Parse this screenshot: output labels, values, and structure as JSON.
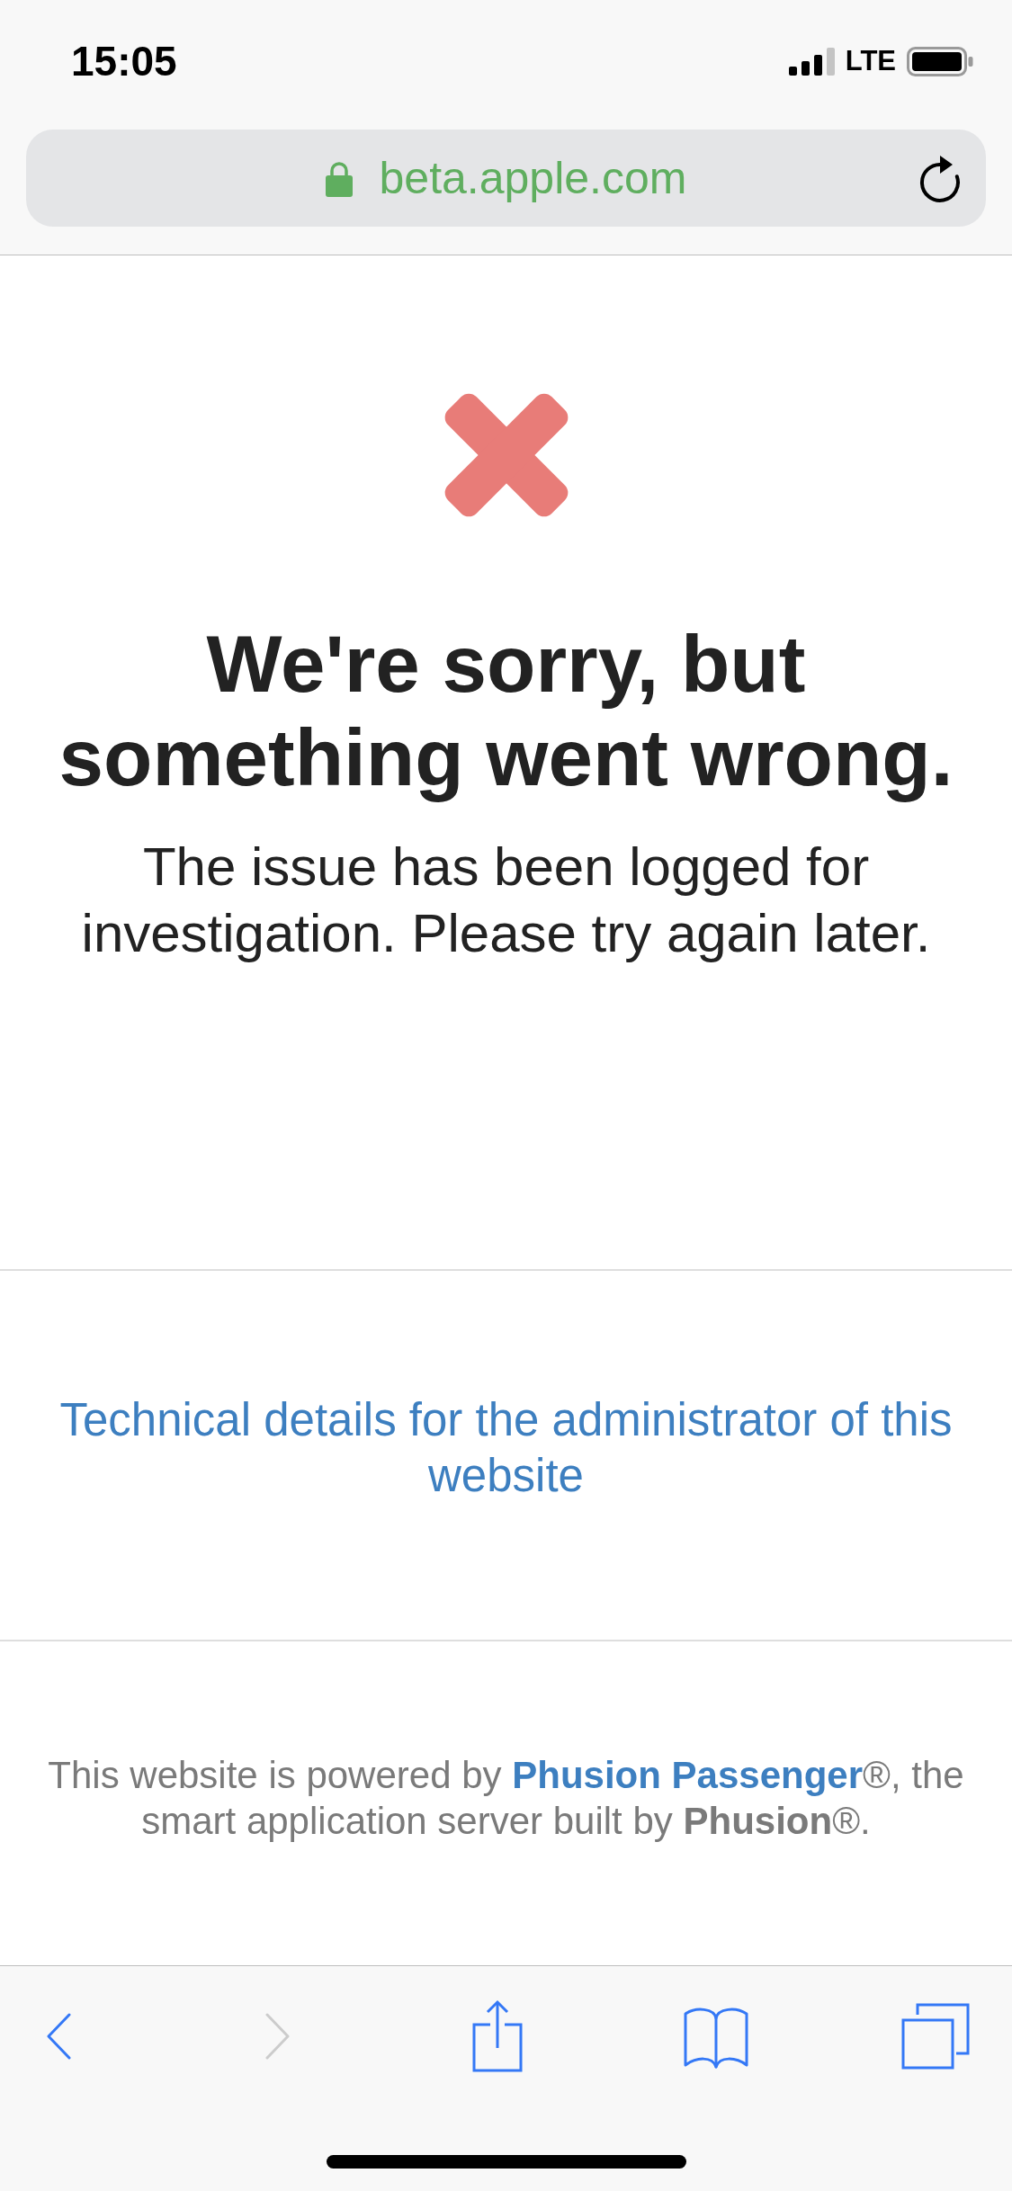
{
  "status_bar": {
    "time": "15:05",
    "network": "LTE"
  },
  "address_bar": {
    "url": "beta.apple.com",
    "secure": true
  },
  "error": {
    "title": "We're sorry, but something went wrong.",
    "message": "The issue has been logged for investigation. Please try again later."
  },
  "details_link": "Technical details for the administrator of this website",
  "footer": {
    "text_before": "This website is powered by ",
    "link": "Phusion Passenger",
    "text_after": "®, the smart application server built by **Phusion**®."
  },
  "toolbar": {
    "items": [
      {
        "kind": "back",
        "disabled": false
      },
      {
        "kind": "forward",
        "disabled": true
      },
      {
        "kind": "share",
        "disabled": false
      },
      {
        "kind": "bookmarks",
        "disabled": false
      },
      {
        "kind": "tabs",
        "disabled": false
      }
    ]
  }
}
